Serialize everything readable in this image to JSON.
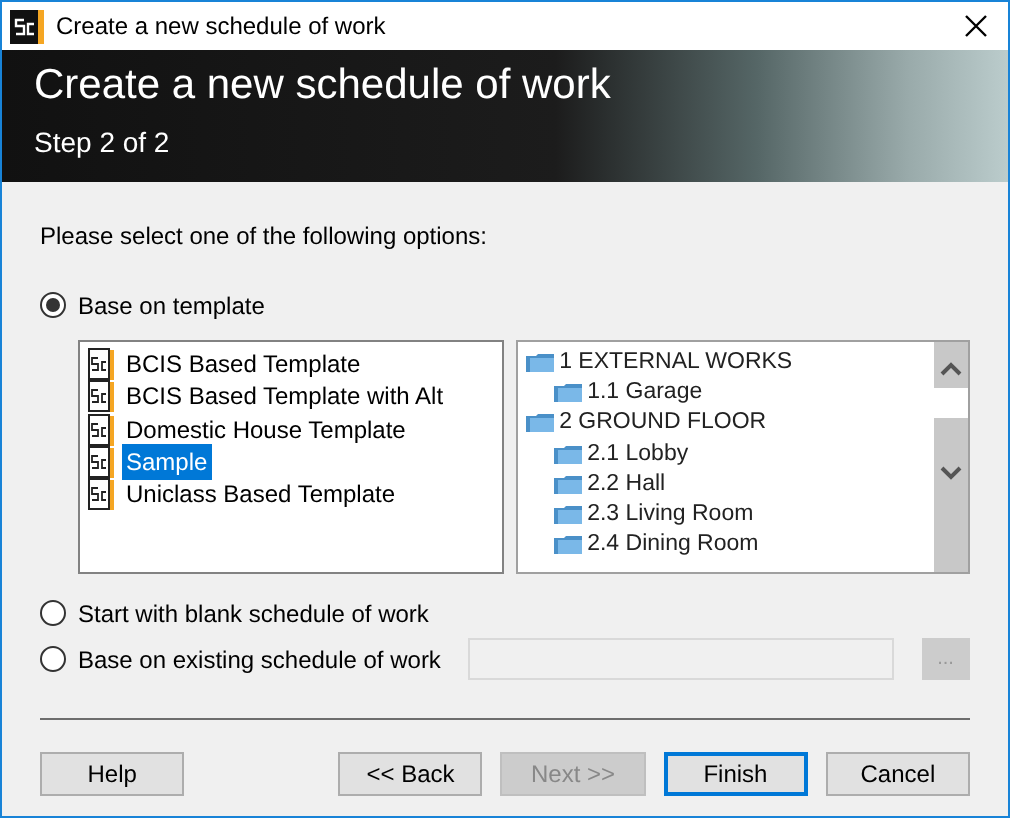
{
  "window": {
    "title": "Create a new schedule of work"
  },
  "header": {
    "title": "Create a new schedule of work",
    "subtitle": "Step 2 of 2"
  },
  "prompt": "Please select one of the following options:",
  "options": [
    {
      "label": "Base on template",
      "selected": true,
      "kind": "template"
    },
    {
      "label": "Start with blank schedule of work",
      "selected": false,
      "kind": "plain"
    },
    {
      "label": "Base on existing schedule of work",
      "selected": false,
      "kind": "file"
    }
  ],
  "templates": [
    {
      "label": "BCIS Based Template",
      "selected": false
    },
    {
      "label": "BCIS Based Template with Alt",
      "selected": false
    },
    {
      "label": "Domestic House Template",
      "selected": false
    },
    {
      "label": "Sample",
      "selected": true
    },
    {
      "label": "Uniclass Based Template",
      "selected": false
    }
  ],
  "tree": [
    {
      "label": "1 EXTERNAL WORKS",
      "children": [
        {
          "label": "1.1 Garage"
        }
      ]
    },
    {
      "label": "2 GROUND FLOOR",
      "children": [
        {
          "label": "2.1 Lobby"
        },
        {
          "label": "2.2 Hall"
        },
        {
          "label": "2.3 Living Room"
        },
        {
          "label": "2.4 Dining Room"
        }
      ]
    }
  ],
  "browse_button": {
    "label": "...",
    "disabled": true
  },
  "buttons": [
    {
      "label": "Help",
      "disabled": false,
      "default": false
    },
    {
      "label": "<< Back",
      "disabled": false,
      "default": false
    },
    {
      "label": "Next >>",
      "disabled": true,
      "default": false
    },
    {
      "label": "Finish",
      "disabled": false,
      "default": true
    },
    {
      "label": "Cancel",
      "disabled": false,
      "default": false
    }
  ]
}
